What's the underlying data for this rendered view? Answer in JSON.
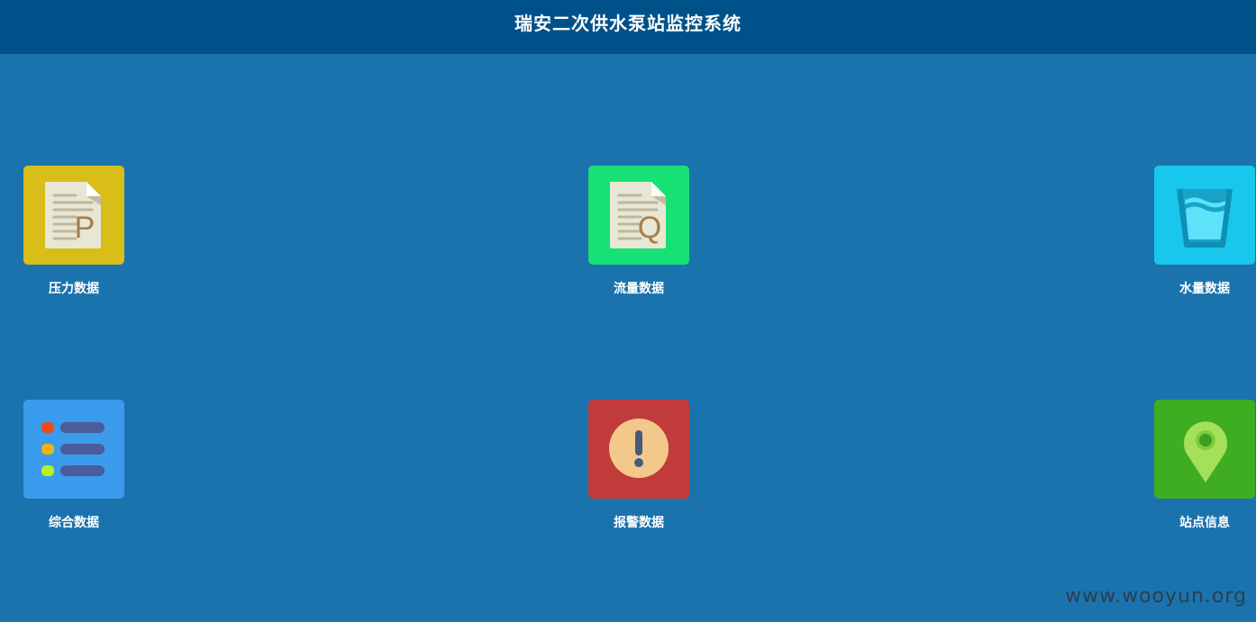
{
  "header": {
    "title": "瑞安二次供水泵站监控系统"
  },
  "tiles": [
    {
      "label": "压力数据",
      "icon": "pressure-document-icon",
      "color": "#d9bd18"
    },
    {
      "label": "流量数据",
      "icon": "flow-document-icon",
      "color": "#17e174"
    },
    {
      "label": "水量数据",
      "icon": "water-cup-icon",
      "color": "#19c6ec"
    },
    {
      "label": "综合数据",
      "icon": "list-icon",
      "color": "#3b9bec"
    },
    {
      "label": "报警数据",
      "icon": "alert-icon",
      "color": "#c23b3b"
    },
    {
      "label": "站点信息",
      "icon": "location-pin-icon",
      "color": "#3ead22"
    }
  ],
  "icon_letters": {
    "pressure": "P",
    "flow": "Q"
  },
  "watermark": "www.wooyun.org",
  "colors": {
    "background": "#1b73ad",
    "header": "#00518a"
  }
}
